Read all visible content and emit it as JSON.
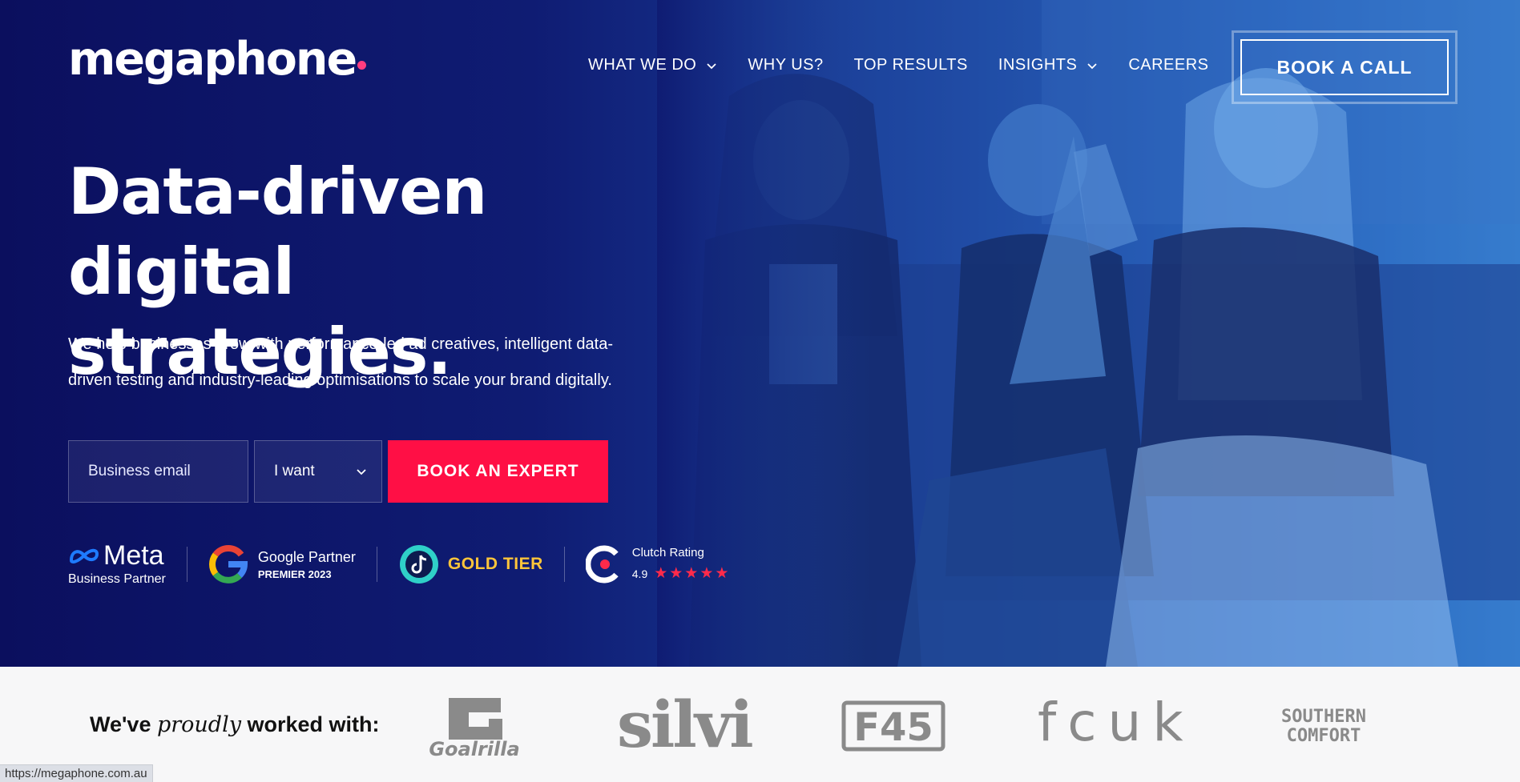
{
  "brand": {
    "logo_text": "megaphone",
    "accent_color": "#ff0f45",
    "dot_color": "#ff3d7f"
  },
  "nav": {
    "items": [
      {
        "label": "WHAT WE DO",
        "has_dropdown": true
      },
      {
        "label": "WHY US?",
        "has_dropdown": false
      },
      {
        "label": "TOP RESULTS",
        "has_dropdown": false
      },
      {
        "label": "INSIGHTS",
        "has_dropdown": true
      },
      {
        "label": "CAREERS",
        "has_dropdown": false
      }
    ],
    "cta": "BOOK A CALL"
  },
  "hero": {
    "headline_line1": "Data-driven digital",
    "headline_line2": "strategies.",
    "subtext_line1": "We help businesses grow with performance-led ad creatives, intelligent data-",
    "subtext_line2": "driven testing and industry-leading optimisations to scale your brand digitally."
  },
  "form": {
    "email_placeholder": "Business email",
    "select_value": "I want",
    "submit_label": "BOOK AN EXPERT"
  },
  "badges": {
    "meta": {
      "word": "Meta",
      "sub": "Business Partner"
    },
    "google": {
      "line1": "Google Partner",
      "line2": "PREMIER 2023"
    },
    "tiktok": {
      "label": "GOLD TIER"
    },
    "clutch": {
      "line1": "Clutch Rating",
      "rating": "4.9",
      "stars": "★★★★★"
    }
  },
  "clients": {
    "label_prefix": "We've ",
    "label_emph": "proudly",
    "label_suffix": " worked with:",
    "logos": [
      "Goalrilla",
      "silvi",
      "F45",
      "fcuk",
      "SOUTHERN COMFORT"
    ]
  },
  "status_bar": {
    "url": "https://megaphone.com.au"
  }
}
